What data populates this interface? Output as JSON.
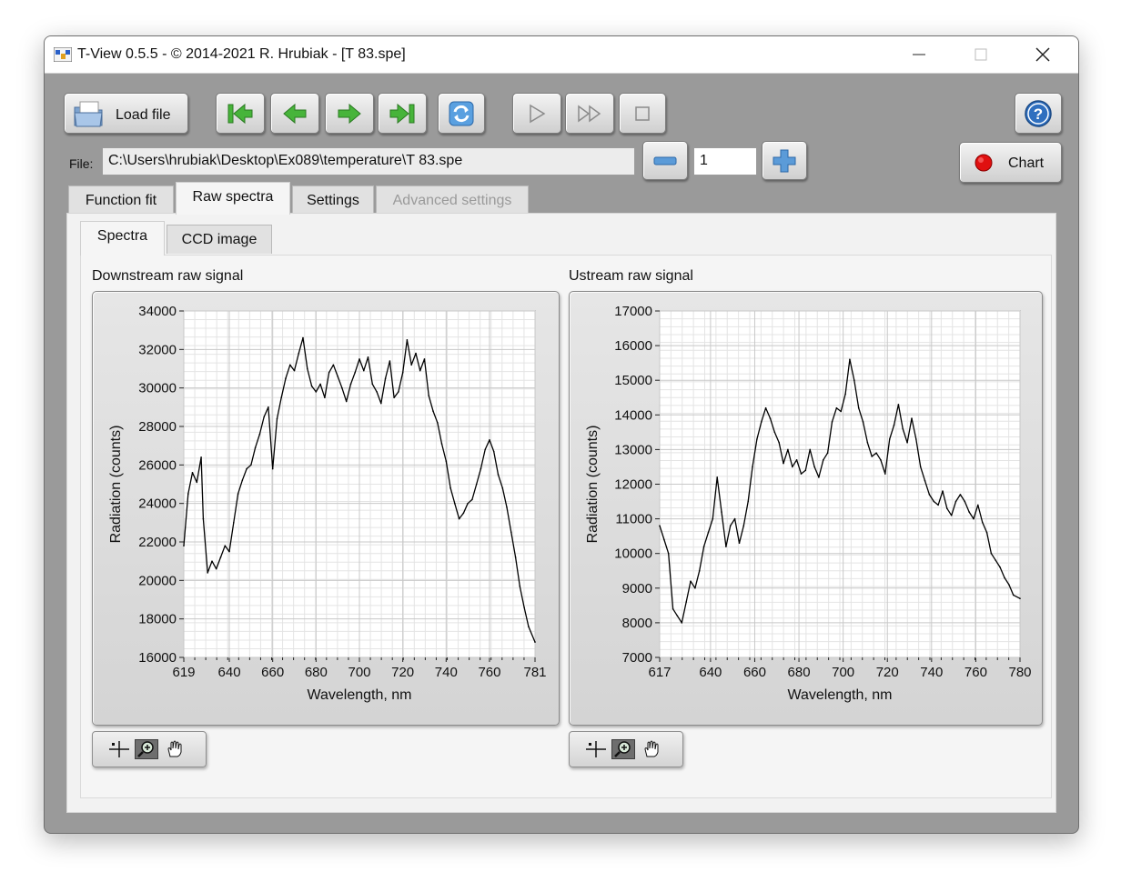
{
  "window": {
    "title": "T-View 0.5.5 - © 2014-2021 R. Hrubiak - [T  83.spe]",
    "minimize_label": "—",
    "close_label": "✕"
  },
  "toolbar": {
    "load_file_label": "Load file",
    "help_label": "?",
    "chart_label": "Chart",
    "icons": [
      "first-file-icon",
      "previous-file-icon",
      "next-file-icon",
      "last-file-icon",
      "refresh-icon",
      "play-icon",
      "fast-forward-icon",
      "stop-icon"
    ]
  },
  "file": {
    "label": "File:",
    "path": "C:\\Users\\hrubiak\\Desktop\\Ex089\\temperature\\T  83.spe",
    "index": "1"
  },
  "tabs": [
    {
      "label": "Function fit",
      "active": false,
      "disabled": false
    },
    {
      "label": "Raw spectra",
      "active": true,
      "disabled": false
    },
    {
      "label": "Settings",
      "active": false,
      "disabled": false
    },
    {
      "label": "Advanced settings",
      "active": false,
      "disabled": true
    }
  ],
  "subtabs": [
    {
      "label": "Spectra",
      "active": true
    },
    {
      "label": "CCD image",
      "active": false
    }
  ],
  "colors": {
    "chart_bg": "#ffffff",
    "grid": "#c8c8c8",
    "trace": "#000000",
    "record_button": "#e01010"
  },
  "chart_data": [
    {
      "type": "line",
      "title": "Downstream raw signal",
      "xlabel": "Wavelength, nm",
      "ylabel": "Radiation (counts)",
      "xlim": [
        619,
        781
      ],
      "ylim": [
        16000,
        34000
      ],
      "xticks": [
        619,
        640,
        660,
        680,
        700,
        720,
        740,
        760,
        781
      ],
      "yticks": [
        16000,
        18000,
        20000,
        22000,
        24000,
        26000,
        28000,
        30000,
        32000,
        34000
      ],
      "grid": true,
      "x": [
        619,
        621,
        623,
        625,
        627,
        628,
        630,
        632,
        634,
        636,
        638,
        640,
        642,
        644,
        646,
        648,
        650,
        652,
        654,
        656,
        658,
        660,
        662,
        664,
        666,
        668,
        670,
        672,
        674,
        676,
        678,
        680,
        682,
        684,
        686,
        688,
        690,
        692,
        694,
        696,
        698,
        700,
        702,
        704,
        706,
        708,
        710,
        712,
        714,
        716,
        718,
        720,
        722,
        724,
        726,
        728,
        730,
        732,
        734,
        736,
        738,
        740,
        742,
        744,
        746,
        748,
        750,
        752,
        754,
        756,
        758,
        760,
        762,
        764,
        766,
        768,
        770,
        772,
        774,
        776,
        778,
        781
      ],
      "y": [
        21800,
        24500,
        25600,
        25100,
        26400,
        23200,
        20400,
        21000,
        20600,
        21200,
        21800,
        21500,
        23000,
        24500,
        25200,
        25800,
        26000,
        26900,
        27600,
        28500,
        29000,
        25800,
        28400,
        29500,
        30500,
        31200,
        30900,
        31800,
        32600,
        31000,
        30100,
        29800,
        30200,
        29500,
        30800,
        31200,
        30600,
        30000,
        29300,
        30200,
        30800,
        31500,
        30900,
        31600,
        30200,
        29800,
        29200,
        30500,
        31400,
        29500,
        29800,
        30800,
        32500,
        31200,
        31800,
        30900,
        31500,
        29600,
        28800,
        28200,
        27100,
        26200,
        24800,
        24000,
        23200,
        23500,
        24000,
        24200,
        25000,
        25800,
        26800,
        27300,
        26700,
        25500,
        24800,
        23800,
        22500,
        21200,
        19700,
        18600,
        17600,
        16800
      ]
    },
    {
      "type": "line",
      "title": "Ustream raw signal",
      "xlabel": "Wavelength, nm",
      "ylabel": "Radiation (counts)",
      "xlim": [
        617,
        780
      ],
      "ylim": [
        7000,
        17000
      ],
      "xticks": [
        617,
        640,
        660,
        680,
        700,
        720,
        740,
        760,
        780
      ],
      "yticks": [
        7000,
        8000,
        9000,
        10000,
        11000,
        12000,
        13000,
        14000,
        15000,
        16000,
        17000
      ],
      "grid": true,
      "x": [
        617,
        619,
        621,
        623,
        625,
        627,
        629,
        631,
        633,
        635,
        637,
        639,
        641,
        643,
        645,
        647,
        649,
        651,
        653,
        655,
        657,
        659,
        661,
        663,
        665,
        667,
        669,
        671,
        673,
        675,
        677,
        679,
        681,
        683,
        685,
        687,
        689,
        691,
        693,
        695,
        697,
        699,
        701,
        703,
        705,
        707,
        709,
        711,
        713,
        715,
        717,
        719,
        721,
        723,
        725,
        727,
        729,
        731,
        733,
        735,
        737,
        739,
        741,
        743,
        745,
        747,
        749,
        751,
        753,
        755,
        757,
        759,
        761,
        763,
        765,
        767,
        769,
        771,
        773,
        775,
        777,
        780
      ],
      "y": [
        10800,
        10400,
        10000,
        8400,
        8200,
        8000,
        8600,
        9200,
        9000,
        9500,
        10200,
        10600,
        11000,
        12200,
        11200,
        10200,
        10800,
        11000,
        10300,
        10800,
        11500,
        12500,
        13300,
        13800,
        14200,
        13900,
        13500,
        13200,
        12600,
        13000,
        12500,
        12700,
        12300,
        12400,
        13000,
        12500,
        12200,
        12700,
        12900,
        13800,
        14200,
        14100,
        14600,
        15600,
        15000,
        14200,
        13800,
        13200,
        12800,
        12900,
        12700,
        12300,
        13300,
        13700,
        14300,
        13600,
        13200,
        13900,
        13300,
        12500,
        12100,
        11700,
        11500,
        11400,
        11800,
        11300,
        11100,
        11500,
        11700,
        11500,
        11200,
        11000,
        11400,
        10900,
        10600,
        10000,
        9800,
        9600,
        9300,
        9100,
        8800,
        8700
      ]
    }
  ]
}
